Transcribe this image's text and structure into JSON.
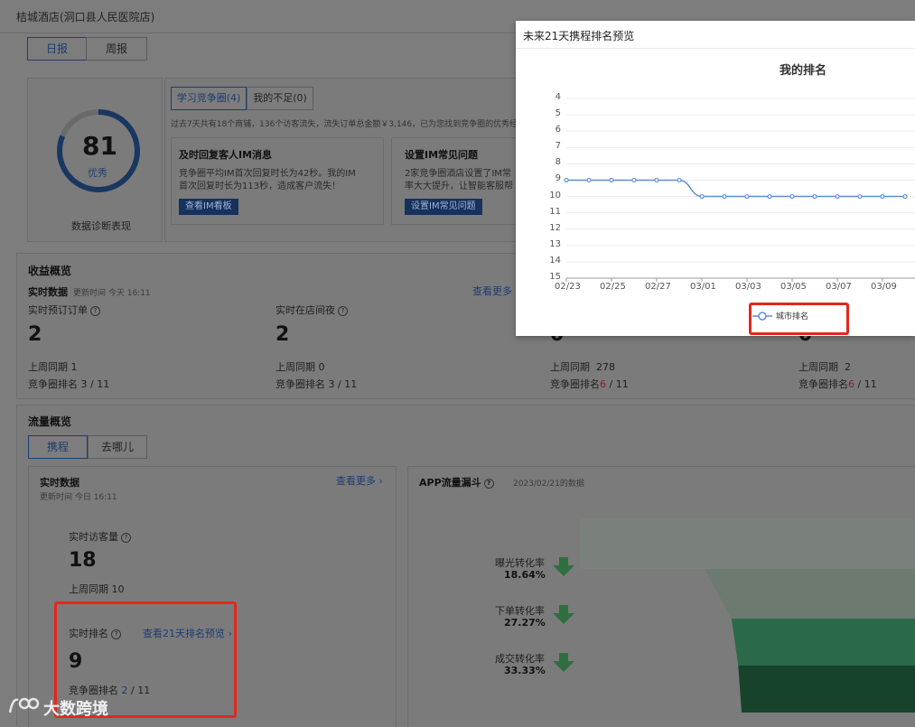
{
  "hotel": {
    "name": "桔城酒店(洞口县人民医院店)"
  },
  "report_tabs": [
    "日报",
    "周报"
  ],
  "diagnosis": {
    "score": "81",
    "grade": "优秀",
    "caption": "数据诊断表现"
  },
  "competition": {
    "tabs": [
      "学习竞争圈(4)",
      "我的不足(0)"
    ],
    "summary": "过去7天共有18个商铺，136个访客流失，流失订单总金额￥3,146，已为您找到竞争圈的优秀经验",
    "cards": [
      {
        "title": "及时回复客人IM消息",
        "body1": "竞争圈平均IM首次回复时长为42秒。我的IM",
        "body2": "首次回复时长为113秒，造成客户流失！",
        "button": "查看IM看板"
      },
      {
        "title": "设置IM常见问题",
        "body1": "2家竞争圈酒店设置了IM常",
        "body2": "率大大提升，让智能客服帮",
        "button": "设置IM常见问题"
      }
    ]
  },
  "revenue": {
    "title": "收益概览",
    "realtime_label": "实时数据",
    "updated": "更新时间 今天 16:11",
    "more": "查看更多",
    "metrics": [
      {
        "label": "实时预订订单",
        "value": "2",
        "prev_label": "上周同期",
        "prev": "1",
        "rank_label": "竞争圈排名",
        "rank": "3",
        "total": "11"
      },
      {
        "label": "实时在店间夜",
        "value": "2",
        "prev_label": "上周同期",
        "prev": "0",
        "rank_label": "竞争圈排名",
        "rank": "3",
        "total": "11"
      },
      {
        "label": "",
        "value": "0",
        "prev_label": "上周同期",
        "prev": "278",
        "rank_label": "竞争圈排名",
        "rank": "6",
        "total": "11"
      },
      {
        "label": "",
        "value": "0",
        "prev_label": "上周同期",
        "prev": "2",
        "rank_label": "竞争圈排名",
        "rank": "6",
        "total": "11"
      }
    ]
  },
  "traffic": {
    "title": "流量概览",
    "tabs": [
      "携程",
      "去哪儿"
    ],
    "realtime_label": "实时数据",
    "updated": "更新时间 今日 16:11",
    "more": "查看更多",
    "visitors_label": "实时访客量",
    "visitors": "18",
    "visitors_prev_label": "上周同期",
    "visitors_prev": "10",
    "rank_label": "实时排名",
    "rank_link": "查看21天排名预览",
    "rank": "9",
    "rank_comp_label": "竞争圈排名",
    "rank_comp": "2",
    "rank_total": "11"
  },
  "funnel": {
    "title": "APP流量漏斗",
    "date": "2023/02/21的数据",
    "rates": [
      {
        "label": "曝光转化率",
        "value": "18.64%"
      },
      {
        "label": "下单转化率",
        "value": "27.27%"
      },
      {
        "label": "成交转化率",
        "value": "33.33%"
      }
    ]
  },
  "modal": {
    "title": "未来21天携程排名预览",
    "chart_data": {
      "type": "line",
      "title": "我的排名",
      "x": [
        "02/23",
        "02/24",
        "02/25",
        "02/26",
        "02/27",
        "02/28",
        "03/01",
        "03/02",
        "03/03",
        "03/04",
        "03/05",
        "03/06",
        "03/07",
        "03/08",
        "03/09",
        "03/10"
      ],
      "x_tick_labels": [
        "02/23",
        "02/25",
        "02/27",
        "03/01",
        "03/03",
        "03/05",
        "03/07",
        "03/09"
      ],
      "y_ticks": [
        "4",
        "5",
        "6",
        "7",
        "8",
        "9",
        "10",
        "11",
        "12",
        "13",
        "14",
        "15"
      ],
      "ylim": [
        4,
        15
      ],
      "y_inverted": true,
      "series": [
        {
          "name": "城市排名",
          "values": [
            9,
            9,
            9,
            9,
            9,
            9,
            10,
            10,
            10,
            10,
            10,
            10,
            10,
            10,
            10,
            10
          ],
          "color": "#5b8fd6"
        }
      ],
      "grid": true,
      "legend_position": "bottom"
    }
  },
  "watermark": "大数跨境",
  "colors": {
    "accent": "#1b3c6e",
    "highlight": "#e3271c",
    "series": "#5b8fd6"
  }
}
